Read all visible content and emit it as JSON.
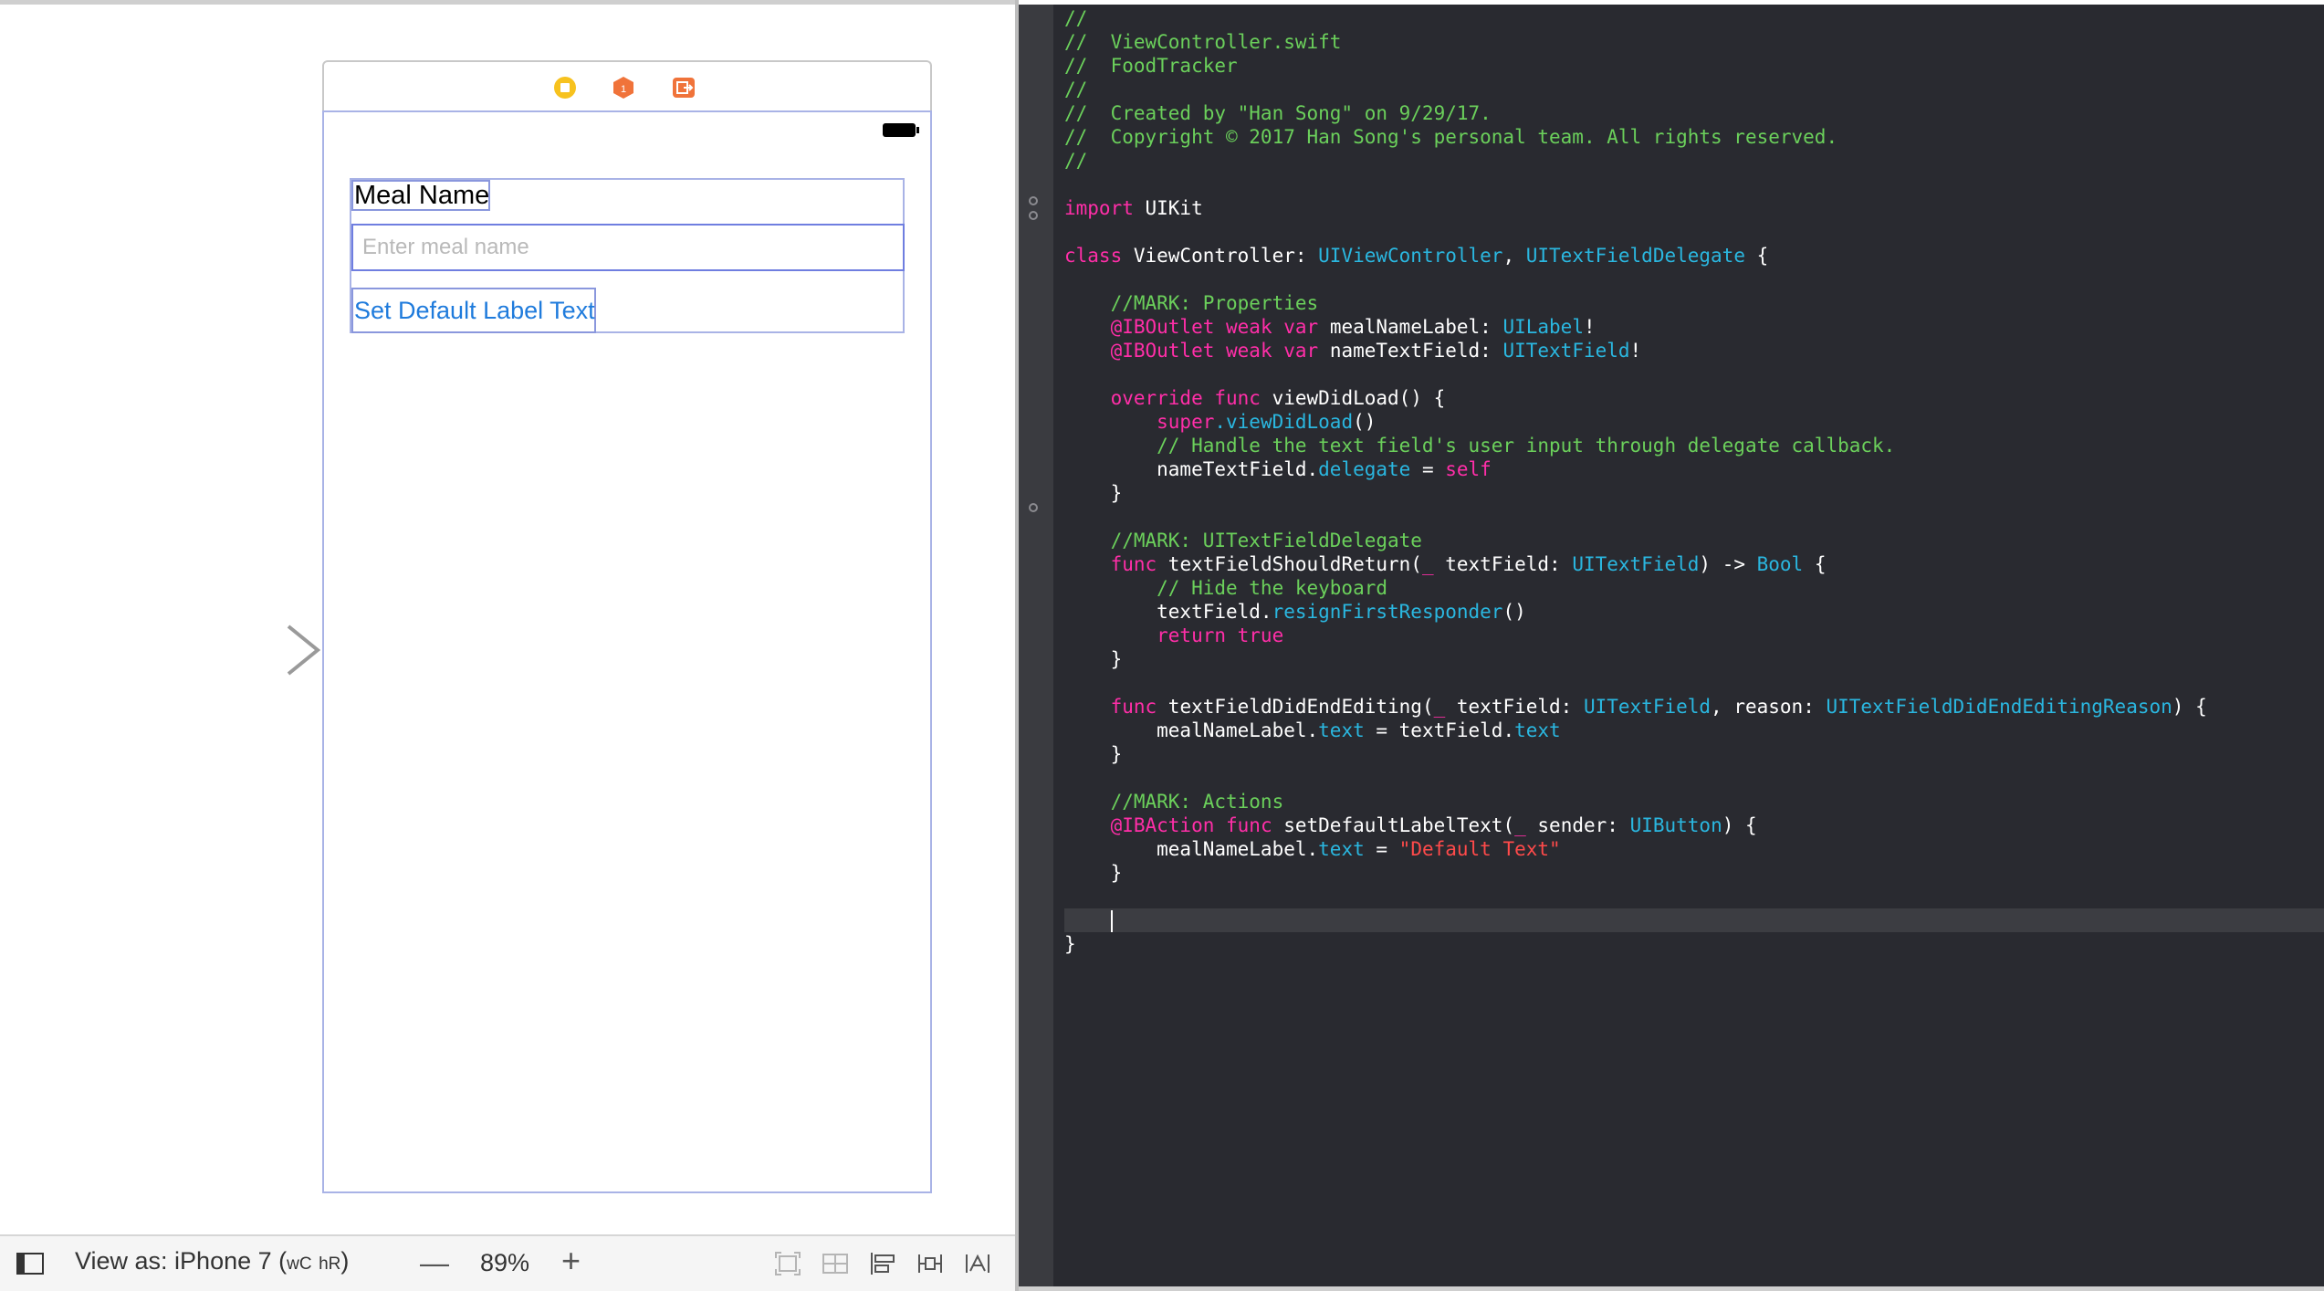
{
  "storyboard": {
    "meal_label_text": "Meal Name",
    "meal_input_placeholder": "Enter meal name",
    "default_button_label": "Set Default Label Text"
  },
  "bottom_bar": {
    "view_as_prefix": "View as: iPhone 7 (",
    "size_w": "wC",
    "size_h": "hR",
    "view_as_suffix": ")",
    "zoom_out_symbol": "—",
    "zoom_level": "89%",
    "zoom_in_symbol": "+"
  },
  "code": {
    "l1": "//",
    "l2": "//  ViewController.swift",
    "l3": "//  FoodTracker",
    "l4": "//",
    "l5": "//  Created by \"Han Song\" on 9/29/17.",
    "l6": "//  Copyright © 2017 Han Song's personal team. All rights reserved.",
    "l7": "//",
    "import_kw": "import",
    "import_mod": " UIKit",
    "class_kw": "class",
    "class_name": " ViewController: ",
    "super1": "UIViewController",
    "comma": ", ",
    "super2": "UITextFieldDelegate",
    "brace_open": " {",
    "mark_props": "    //MARK: Properties",
    "iboutlet": "    @IBOutlet",
    "weak_var": " weak var",
    "outlet1_name": " mealNameLabel: ",
    "outlet1_type": "UILabel",
    "bang": "!",
    "outlet2_name": " nameTextField: ",
    "outlet2_type": "UITextField",
    "override_func": "    override func",
    "viewdidload_sig": " viewDidLoad() {",
    "super_kw": "        super",
    "super_call": ".viewDidLoad",
    "parens": "()",
    "handle_comment": "        // Handle the text field's user input through delegate callback.",
    "ntf": "        nameTextField.",
    "delegate_prop": "delegate",
    "assign": " = ",
    "self_kw": "self",
    "close_brace_4": "    }",
    "mark_delegate": "    //MARK: UITextFieldDelegate",
    "func_kw": "    func",
    "tfsr_sig": " textFieldShouldReturn(",
    "underscore": "_",
    "tf_param": " textField: ",
    "uitextfield": "UITextField",
    "arrow": ") -> ",
    "bool_type": "Bool",
    "brace_tail": " {",
    "hide_comment": "        // Hide the keyboard",
    "tf_dot": "        textField.",
    "resign": "resignFirstResponder",
    "return_true": "        return true",
    "tfdee_sig": " textFieldDidEndEditing(",
    "reason_label": ", reason: ",
    "reason_type": "UITextFieldDidEndEditingReason",
    "brace_tail2": ") {",
    "mnl": "        mealNameLabel.",
    "text_prop": "text",
    "eq_tf": " = textField.",
    "mark_actions": "    //MARK: Actions",
    "ibaction": "    @IBAction",
    "func_kw2": " func",
    "sdlt_sig": " setDefaultLabelText(",
    "sender_param": " sender: ",
    "uibutton": "UIButton",
    "default_str": "\"Default Text\"",
    "indent4": "    ",
    "close_brace_0": "}"
  }
}
